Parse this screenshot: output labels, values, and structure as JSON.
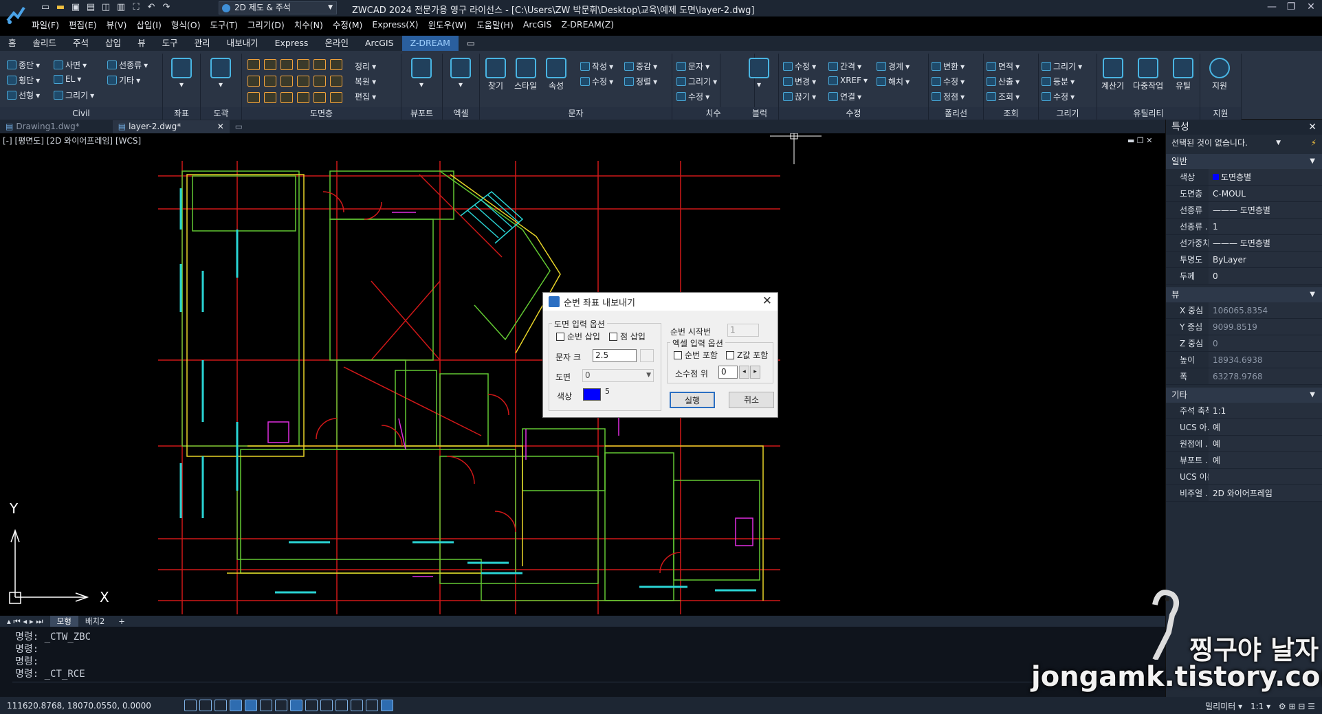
{
  "title_bar": {
    "workspace": "2D 제도 & 주석",
    "title": "ZWCAD 2024 전문가용 영구 라이선스 - [C:\\Users\\ZW 박문휘\\Desktop\\교육\\예제 도면\\layer-2.dwg]"
  },
  "menu": [
    "파일(F)",
    "편집(E)",
    "뷰(V)",
    "삽입(I)",
    "형식(O)",
    "도구(T)",
    "그리기(D)",
    "치수(N)",
    "수정(M)",
    "Express(X)",
    "윈도우(W)",
    "도움말(H)",
    "ArcGIS",
    "Z-DREAM(Z)"
  ],
  "ribbon_tabs": [
    "홈",
    "솔리드",
    "주석",
    "삽입",
    "뷰",
    "도구",
    "관리",
    "내보내기",
    "Express",
    "온라인",
    "ArcGIS",
    "Z-DREAM"
  ],
  "ribbon_active_tab": "Z-DREAM",
  "ribbon": {
    "civil": {
      "label": "Civil",
      "items": [
        "종단",
        "횡단",
        "선형",
        "사면",
        "EL",
        "그리기",
        "선종류",
        "기타"
      ]
    },
    "coord": {
      "label": "좌표"
    },
    "frame": {
      "label": "도곽"
    },
    "layer": {
      "label": "도면층",
      "items": [
        "정리",
        "복원",
        "편집"
      ]
    },
    "viewport": {
      "label": "뷰포트"
    },
    "excel": {
      "label": "엑셀"
    },
    "text": {
      "label": "문자",
      "items": [
        "찾기",
        "스타일",
        "속성",
        "작성",
        "수정",
        "증감",
        "정렬"
      ]
    },
    "dim": {
      "label": "치수",
      "items": [
        "문자",
        "그리기",
        "수정"
      ]
    },
    "block": {
      "label": "블럭"
    },
    "modify": {
      "label": "수정",
      "items": [
        "수정",
        "변경",
        "끊기",
        "간격",
        "XREF",
        "연결",
        "경계",
        "해치"
      ]
    },
    "polyline": {
      "label": "폴리선",
      "items": [
        "변환",
        "수정",
        "정점"
      ]
    },
    "query": {
      "label": "조회",
      "items": [
        "면적",
        "산출",
        "조회"
      ]
    },
    "draw": {
      "label": "그리기",
      "items": [
        "그리기",
        "등분",
        "수정"
      ]
    },
    "utility": {
      "label": "유틸리티",
      "items": [
        "계산기",
        "다중작업",
        "유틸"
      ]
    },
    "support": {
      "label": "지원",
      "items": [
        "지원"
      ]
    }
  },
  "doc_tabs": [
    {
      "name": "Drawing1.dwg*",
      "active": false
    },
    {
      "name": "layer-2.dwg*",
      "active": true
    }
  ],
  "viewport_label": "[-] [평면도] [2D 와이어프레임] [WCS]",
  "ucs": {
    "y": "Y",
    "x": "X"
  },
  "layout_tabs": [
    "모형",
    "배치2",
    "+"
  ],
  "command_lines": [
    "명령: _CTW_ZBC",
    "명령:",
    "명령:",
    "명령: _CT_RCE"
  ],
  "status": {
    "coords": "111620.8768, 18070.0550, 0.0000",
    "units": "밀리미터",
    "scale": "1:1"
  },
  "properties": {
    "title": "특성",
    "selection": "선택된 것이 없습니다.",
    "general": {
      "label": "일반",
      "rows": [
        {
          "k": "색상",
          "v": "도면층별"
        },
        {
          "k": "도면층",
          "v": "C-MOUL"
        },
        {
          "k": "선종류",
          "v": "——— 도면층별"
        },
        {
          "k": "선종류 ...",
          "v": "1"
        },
        {
          "k": "선가중치",
          "v": "——— 도면층별"
        },
        {
          "k": "투명도",
          "v": "ByLayer"
        },
        {
          "k": "두께",
          "v": "0"
        }
      ]
    },
    "view": {
      "label": "뷰",
      "rows": [
        {
          "k": "X 중심",
          "v": "106065.8354"
        },
        {
          "k": "Y 중심",
          "v": "9099.8519"
        },
        {
          "k": "Z 중심",
          "v": "0"
        },
        {
          "k": "높이",
          "v": "18934.6938"
        },
        {
          "k": "폭",
          "v": "63278.9768"
        }
      ]
    },
    "misc": {
      "label": "기타",
      "rows": [
        {
          "k": "주석 축척",
          "v": "1:1"
        },
        {
          "k": "UCS 아...",
          "v": "예"
        },
        {
          "k": "원점에 ...",
          "v": "예"
        },
        {
          "k": "뷰포트 ...",
          "v": "예"
        },
        {
          "k": "UCS 이름",
          "v": ""
        },
        {
          "k": "비주얼 ...",
          "v": "2D 와이어프레임"
        }
      ]
    }
  },
  "dialog": {
    "title": "순번 좌표 내보내기",
    "drawing_group": "도면 입력 옵션",
    "chk_number": "순번 삽입",
    "chk_point": "점 삽입",
    "text_size_label": "문자 크",
    "text_size": "2.5",
    "layer_label": "도면",
    "layer_value": "0",
    "color_label": "색상",
    "color_value": "5",
    "start_label": "순번 시작번",
    "start_value": "1",
    "excel_group": "엑셀 입력 옵션",
    "chk_inc_number": "순번 포함",
    "chk_inc_z": "Z값 포함",
    "decimal_label": "소수점 위",
    "decimal_value": "0",
    "run": "실행",
    "cancel": "취소"
  },
  "watermark": {
    "line1": "찡구야 날자",
    "line2": "jongamk.tistory.com"
  },
  "colors": {
    "accent": "#2a5f9e",
    "dialog_color": "#0000ff",
    "layer_swatch": "#0000ff"
  }
}
